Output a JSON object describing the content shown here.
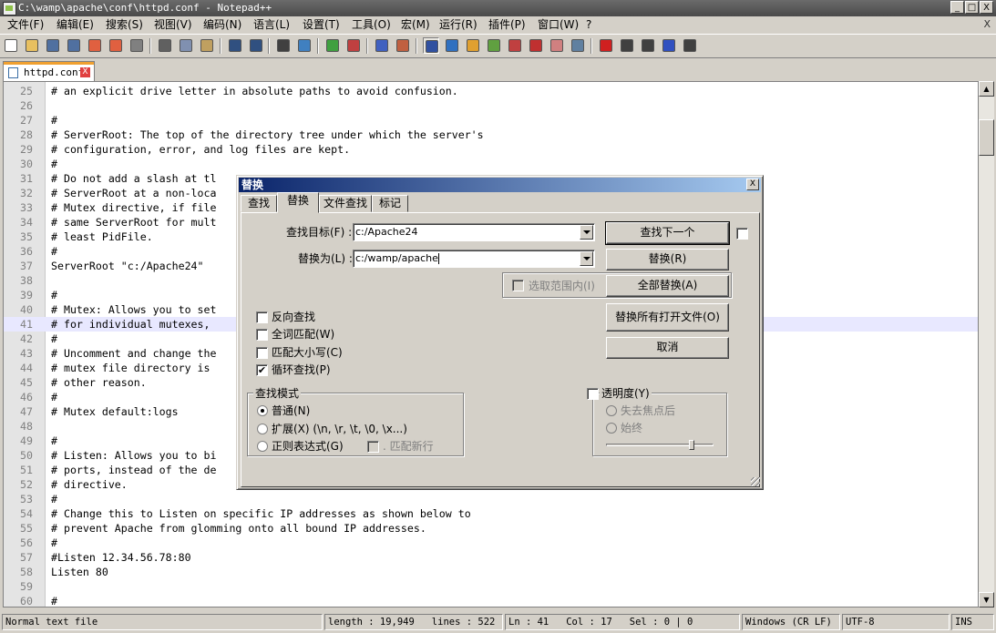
{
  "window": {
    "title": "C:\\wamp\\apache\\conf\\httpd.conf - Notepad++",
    "controls": [
      "_",
      "□",
      "X"
    ]
  },
  "menu": [
    "文件(F)",
    "编辑(E)",
    "搜索(S)",
    "视图(V)",
    "编码(N)",
    "语言(L)",
    "设置(T)",
    "工具(O)",
    "宏(M)",
    "运行(R)",
    "插件(P)",
    "窗口(W)",
    "?"
  ],
  "menu_close": "X",
  "toolbar": {
    "icons": [
      "new-file",
      "open-file",
      "save",
      "save-all",
      "close",
      "close-all",
      "print",
      "cut",
      "copy",
      "paste",
      "undo",
      "redo",
      "find",
      "replace",
      "zoom-in",
      "zoom-out",
      "sync-vertical",
      "sync-horizontal",
      "word-wrap",
      "show-all-chars",
      "indent-guide",
      "user-defined-language",
      "doc-map",
      "function-list",
      "folder-as-workspace",
      "monitor",
      "record-macro",
      "stop-record",
      "play-macro",
      "run-macro-multiple",
      "save-macro"
    ],
    "icon_colors": [
      "#ffffff",
      "#e8c060",
      "#5070a0",
      "#5070a0",
      "#e06040",
      "#e06040",
      "#808080",
      "#606060",
      "#8090b0",
      "#c0a060",
      "#305080",
      "#305080",
      "#404040",
      "#4080c0",
      "#40a040",
      "#c04040",
      "#4060c0",
      "#c06040",
      "#3050a0",
      "#3070c0",
      "#e0a030",
      "#60a040",
      "#c04040",
      "#c03030",
      "#d08080",
      "#6080a0",
      "#d02020",
      "#404040",
      "#404040",
      "#3050c0",
      "#404040"
    ]
  },
  "tab": {
    "label": "httpd.conf",
    "close": "X"
  },
  "editor": {
    "lines": [
      {
        "n": "25",
        "code": "# an explicit drive letter in absolute paths to avoid confusion."
      },
      {
        "n": "26",
        "code": ""
      },
      {
        "n": "27",
        "code": "#"
      },
      {
        "n": "28",
        "code": "# ServerRoot: The top of the directory tree under which the server's"
      },
      {
        "n": "29",
        "code": "# configuration, error, and log files are kept."
      },
      {
        "n": "30",
        "code": "#"
      },
      {
        "n": "31",
        "code": "# Do not add a slash at tl"
      },
      {
        "n": "32",
        "code": "# ServerRoot at a non-loca"
      },
      {
        "n": "33",
        "code": "# Mutex directive, if file"
      },
      {
        "n": "34",
        "code": "# same ServerRoot for mult"
      },
      {
        "n": "35",
        "code": "# least PidFile."
      },
      {
        "n": "36",
        "code": "#"
      },
      {
        "n": "37",
        "code": "ServerRoot \"c:/Apache24\""
      },
      {
        "n": "38",
        "code": ""
      },
      {
        "n": "39",
        "code": "#"
      },
      {
        "n": "40",
        "code": "# Mutex: Allows you to set"
      },
      {
        "n": "41",
        "code": "# for individual mutexes,"
      },
      {
        "n": "42",
        "code": "#"
      },
      {
        "n": "43",
        "code": "# Uncomment and change the"
      },
      {
        "n": "44",
        "code": "# mutex file directory is"
      },
      {
        "n": "45",
        "code": "# other reason."
      },
      {
        "n": "46",
        "code": "#"
      },
      {
        "n": "47",
        "code": "# Mutex default:logs"
      },
      {
        "n": "48",
        "code": ""
      },
      {
        "n": "49",
        "code": "#"
      },
      {
        "n": "50",
        "code": "# Listen: Allows you to bi"
      },
      {
        "n": "51",
        "code": "# ports, instead of the de"
      },
      {
        "n": "52",
        "code": "# directive."
      },
      {
        "n": "53",
        "code": "#"
      },
      {
        "n": "54",
        "code": "# Change this to Listen on specific IP addresses as shown below to"
      },
      {
        "n": "55",
        "code": "# prevent Apache from glomming onto all bound IP addresses."
      },
      {
        "n": "56",
        "code": "#"
      },
      {
        "n": "57",
        "code": "#Listen 12.34.56.78:80"
      },
      {
        "n": "58",
        "code": "Listen 80"
      },
      {
        "n": "59",
        "code": ""
      },
      {
        "n": "60",
        "code": "#"
      }
    ],
    "highlight_line": "41",
    "highlight_color": "#e8e8ff"
  },
  "statusbar": {
    "file_type": "Normal text file",
    "length": "length : 19,949",
    "lines": "lines : 522",
    "ln": "Ln : 41",
    "col": "Col : 17",
    "sel": "Sel : 0 | 0",
    "eol": "Windows (CR LF)",
    "encoding": "UTF-8",
    "mode": "INS"
  },
  "dialog": {
    "title": "替换",
    "close": "X",
    "tabs": [
      "查找",
      "替换",
      "文件查找",
      "标记"
    ],
    "active_tab": "替换",
    "find_label": "查找目标(F) :",
    "find_value": "c:/Apache24",
    "replace_label": "替换为(L) :",
    "replace_value": "c:/wamp/apache",
    "in_selection_label": "选取范围内(I)",
    "buttons": {
      "find_next": "查找下一个",
      "replace": "替换(R)",
      "replace_all": "全部替换(A)",
      "replace_all_open": "替换所有打开文件(O)",
      "cancel": "取消"
    },
    "options": [
      {
        "label": "反向查找",
        "checked": false
      },
      {
        "label": "全词匹配(W)",
        "checked": false
      },
      {
        "label": "匹配大小写(C)",
        "checked": false
      },
      {
        "label": "循环查找(P)",
        "checked": true
      }
    ],
    "search_mode": {
      "title": "查找模式",
      "modes": [
        "普通(N)",
        "扩展(X) (\\n, \\r, \\t, \\0, \\x...)",
        "正则表达式(G)"
      ],
      "selected": "普通(N)",
      "dot_newline": ". 匹配新行"
    },
    "transparency": {
      "label": "透明度(Y)",
      "checked": false,
      "options": [
        "失去焦点后",
        "始终"
      ],
      "level": 0.8
    }
  }
}
